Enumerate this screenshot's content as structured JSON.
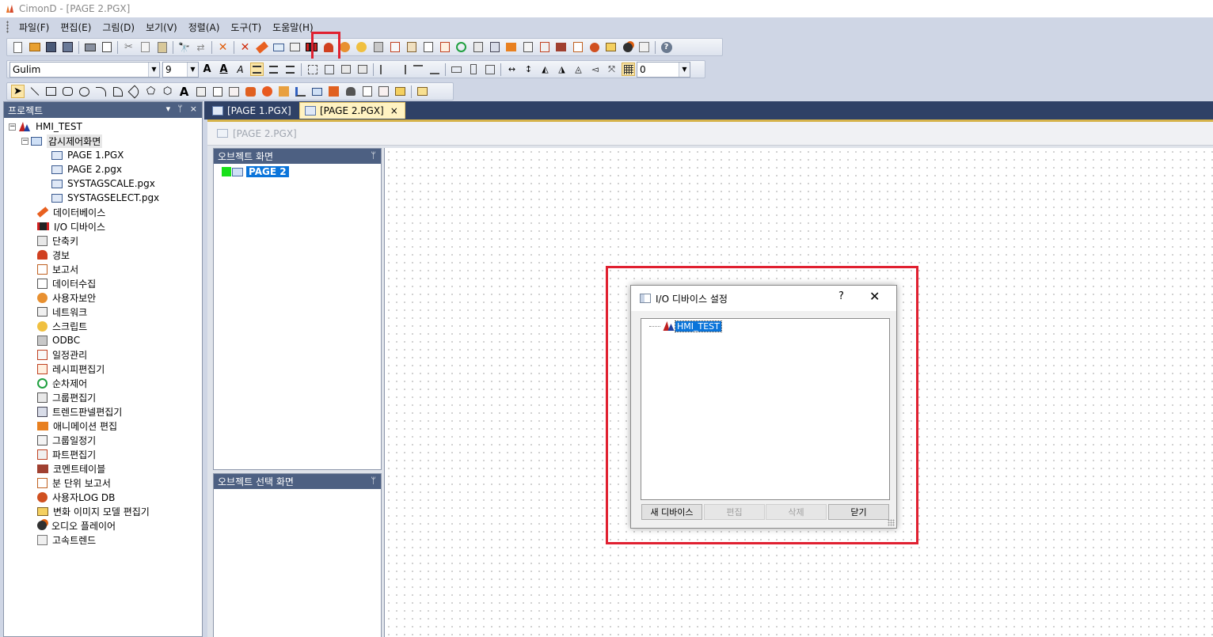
{
  "window": {
    "title": "CimonD - [PAGE 2.PGX]"
  },
  "menu": [
    "파일(F)",
    "편집(E)",
    "그림(D)",
    "보기(V)",
    "정렬(A)",
    "도구(T)",
    "도움말(H)"
  ],
  "format_toolbar": {
    "font": "Gulim",
    "size": "9",
    "line_width": "0"
  },
  "project_panel": {
    "title": "프로젝트",
    "ctrl_dropdown": "▾",
    "ctrl_pin": "ᛘ",
    "ctrl_close": "×",
    "root": "HMI_TEST",
    "screens_folder": "감시제어화면",
    "pages": [
      "PAGE 1.PGX",
      "PAGE 2.pgx",
      "SYSTAGSCALE.pgx",
      "SYSTAGSELECT.pgx"
    ],
    "items": [
      "데이터베이스",
      "I/O 디바이스",
      "단축키",
      "경보",
      "보고서",
      "데이터수집",
      "사용자보안",
      "네트워크",
      "스크립트",
      "ODBC",
      "일정관리",
      "레시피편집기",
      "순차제어",
      "그룹편집기",
      "트렌드판넬편집기",
      "애니메이션 편집",
      "그룹일정기",
      "파트편집기",
      "코멘트테이블",
      "분 단위 보고서",
      "사용자LOG DB",
      "변화 이미지 모델 편집기",
      "오디오 플레이어",
      "고속트렌드"
    ]
  },
  "tabs": [
    {
      "label": "[PAGE 1.PGX]",
      "active": false
    },
    {
      "label": "[PAGE 2.PGX]",
      "active": true,
      "close": "×"
    }
  ],
  "document": {
    "caption": "[PAGE 2.PGX]",
    "object_panel": {
      "title": "오브젝트 화면",
      "pin": "ᛘ",
      "item": "PAGE 2"
    },
    "object_select_panel": {
      "title": "오브젝트 선택 화면",
      "pin": "ᛘ"
    }
  },
  "dialog": {
    "title": "I/O 디바이스 설정",
    "help": "?",
    "close": "✕",
    "tree_root": "HMI_TEST",
    "buttons": [
      {
        "label": "새 디바이스",
        "enabled": true
      },
      {
        "label": "편집",
        "enabled": false
      },
      {
        "label": "삭제",
        "enabled": false
      },
      {
        "label": "닫기",
        "enabled": true
      }
    ]
  },
  "colors": {
    "highlight": "#e02030",
    "panel_header": "#4d6082",
    "tab_bar": "#2f4166",
    "selection": "#0a74da"
  }
}
